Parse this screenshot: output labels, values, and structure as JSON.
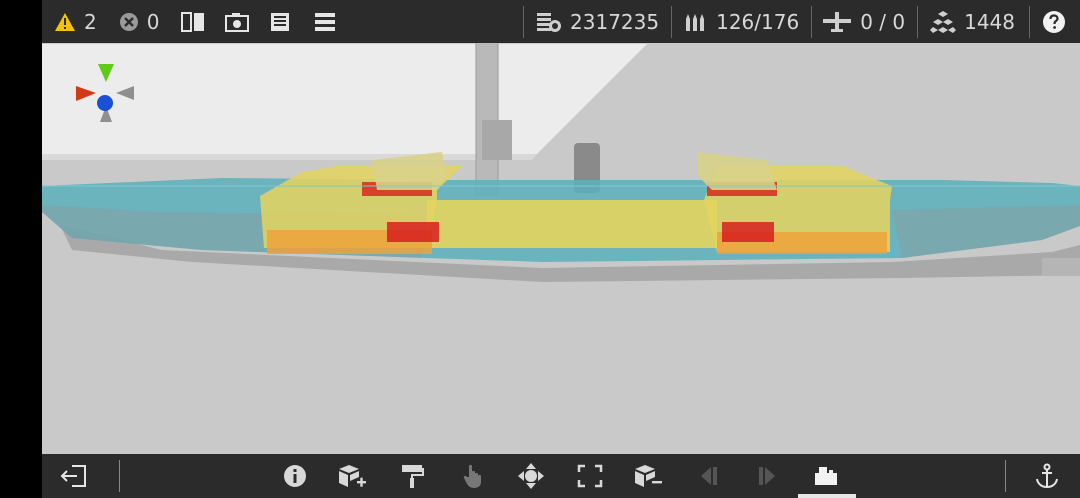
{
  "topbar": {
    "warnings_count": "2",
    "errors_count": "0",
    "cost_value": "2317235",
    "ammo_value": "126/176",
    "aircraft_value": "0 / 0",
    "blocks_value": "1448",
    "icons": {
      "warning": "warning-triangle-icon",
      "error": "error-x-icon",
      "split": "split-view-icon",
      "camera": "camera-icon",
      "save": "save-icon",
      "menu": "menu-icon",
      "cost": "cost-icon",
      "ammo": "ammo-icon",
      "aircraft": "aircraft-icon",
      "blocks": "blocks-icon",
      "help": "help-icon"
    }
  },
  "bottombar": {
    "icons": [
      "exit-icon",
      "info-icon",
      "add-block-icon",
      "paint-roller-icon",
      "touch-icon",
      "move-icon",
      "frame-icon",
      "remove-block-icon",
      "step-back-icon",
      "step-forward-icon",
      "armor-view-icon",
      "anchor-icon"
    ]
  },
  "colors": {
    "bar_bg": "#2b2b2b",
    "viewport_bg": "#c9c9c9",
    "warning_yellow": "#f5c400",
    "axis_red": "#d23a16",
    "axis_green": "#5ecb16",
    "axis_blue": "#1a4fd8",
    "axis_gray": "#8f8f8f",
    "zone_teal": "#3fb3c3",
    "zone_yellow": "#e4d45e",
    "zone_orange": "#eea23a",
    "zone_red": "#d81e1e"
  }
}
